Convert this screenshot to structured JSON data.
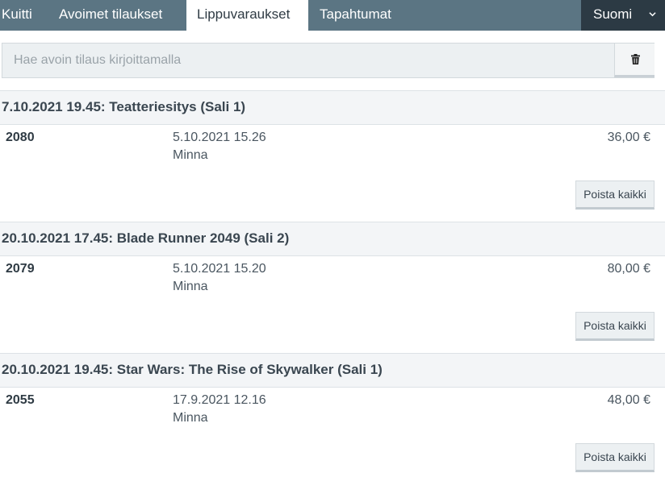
{
  "nav": {
    "tabs": [
      {
        "label": "Kuitti",
        "active": false
      },
      {
        "label": "Avoimet tilaukset",
        "active": false
      },
      {
        "label": "Lippuvaraukset",
        "active": true
      },
      {
        "label": "Tapahtumat",
        "active": false
      }
    ],
    "language": "Suomi",
    "language_icon": "chevron-down-icon"
  },
  "search": {
    "placeholder": "Hae avoin tilaus kirjoittamalla",
    "value": "",
    "clear_icon": "trash-icon"
  },
  "events": [
    {
      "title": "7.10.2021 19.45: Teatteriesitys (Sali 1)",
      "orders": [
        {
          "id": "2080",
          "date": "5.10.2021 15.26",
          "name": "Minna",
          "price": "36,00 €"
        }
      ],
      "delete_label": "Poista kaikki"
    },
    {
      "title": "20.10.2021 17.45: Blade Runner 2049 (Sali 2)",
      "orders": [
        {
          "id": "2079",
          "date": "5.10.2021 15.20",
          "name": "Minna",
          "price": "80,00 €"
        }
      ],
      "delete_label": "Poista kaikki"
    },
    {
      "title": "20.10.2021 19.45: Star Wars: The Rise of Skywalker (Sali 1)",
      "orders": [
        {
          "id": "2055",
          "date": "17.9.2021 12.16",
          "name": "Minna",
          "price": "48,00 €"
        }
      ],
      "delete_label": "Poista kaikki"
    }
  ],
  "colors": {
    "nav_bg": "#5b7583",
    "nav_active_bg": "#ffffff",
    "lang_bg": "#2c3a44",
    "header_bg": "#f3f5f7"
  }
}
